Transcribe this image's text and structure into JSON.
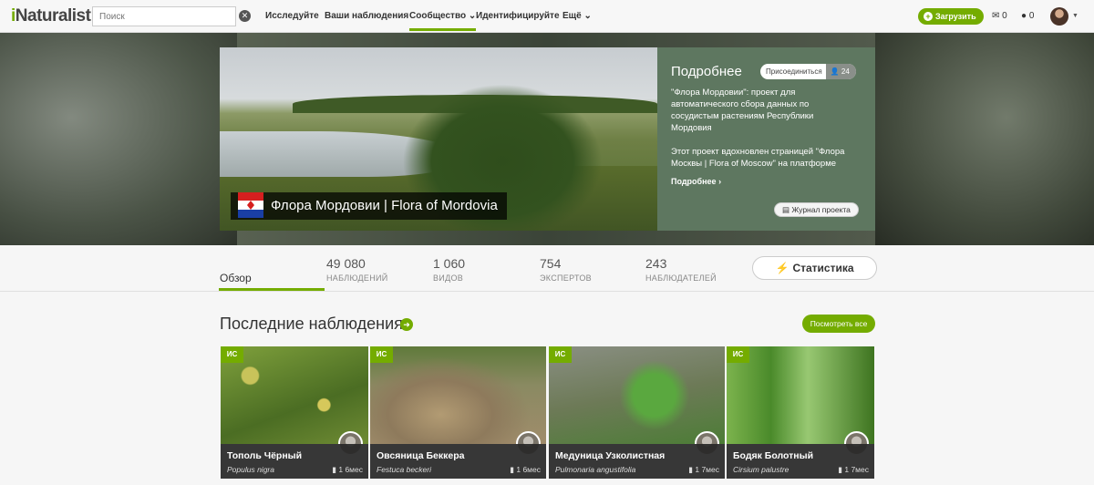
{
  "nav": {
    "logo_i": "i",
    "logo_rest": "Naturalist",
    "search_placeholder": "Поиск",
    "links": [
      "Исследуйте",
      "Ваши наблюдения",
      "Сообщество",
      "Идентифицируйте",
      "Ещё"
    ],
    "upload_label": "Загрузить",
    "messages_count": "0",
    "notifications_count": "0"
  },
  "project": {
    "title": "Флора Мордовии | Flora of Mordovia",
    "info_title": "Подробнее",
    "join_label": "Присоединиться",
    "members_count": "24",
    "desc1": "\"Флора Мордовии\": проект для автоматического сбора данных по сосудистым растениям Республики Мордовия",
    "desc2": "Этот проект вдохновлен страницей \"Флора Москвы | Flora of Moscow\" на платформе",
    "more_label": "Подробнее",
    "journal_label": "Журнал проекта"
  },
  "stats": {
    "overview_tab": "Обзор",
    "items": [
      {
        "num": "49 080",
        "label": "НАБЛЮДЕНИЙ"
      },
      {
        "num": "1 060",
        "label": "ВИДОВ"
      },
      {
        "num": "754",
        "label": "ЭКСПЕРТОВ"
      },
      {
        "num": "243",
        "label": "НАБЛЮДАТЕЛЕЙ"
      }
    ],
    "stats_button": "Статистика"
  },
  "recent": {
    "title": "Последние наблюдения",
    "view_all": "Посмотреть все",
    "cards": [
      {
        "badge": "ИС",
        "name": "Тополь Чёрный",
        "latin": "Populus nigra",
        "age": "1 6мес"
      },
      {
        "badge": "ИС",
        "name": "Овсяница Беккера",
        "latin": "Festuca beckeri",
        "age": "1 6мес"
      },
      {
        "badge": "ИС",
        "name": "Медуница Узколистная",
        "latin": "Pulmonaria angustifolia",
        "age": "1 7мес"
      },
      {
        "badge": "ИС",
        "name": "Бодяк Болотный",
        "latin": "Cirsium palustre",
        "age": "1 7мес"
      }
    ]
  },
  "colors": {
    "accent": "#74ac00",
    "info_panel": "#5e7760"
  }
}
